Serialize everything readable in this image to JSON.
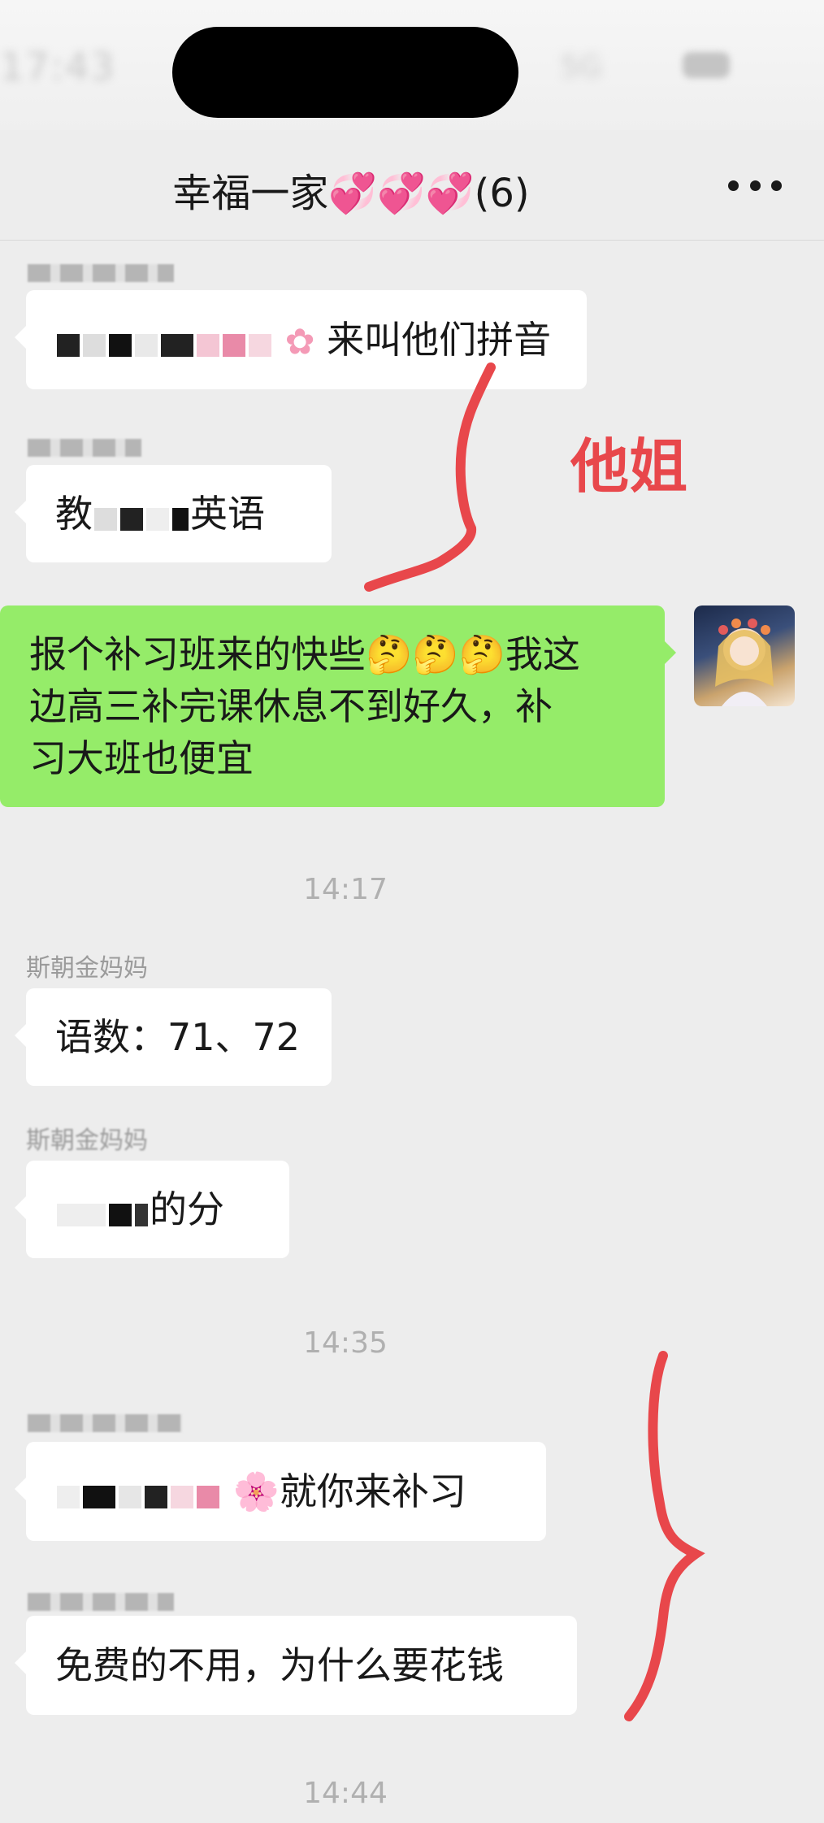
{
  "status_bar": {
    "time": "17:43",
    "network": "5G"
  },
  "header": {
    "title": "幸福一家💞💞💞(6)"
  },
  "messages": [
    {
      "text": "来叫他们拼音",
      "sender": ""
    },
    {
      "text": "英语",
      "prefix": "教",
      "sender": ""
    },
    {
      "text": "报个补习班来的快些🤔🤔🤔我这边高三补完课休息不到好久，补习大班也便宜",
      "line1": "报个补习班来的快些🤔🤔🤔我这",
      "line2": "边高三补完课休息不到好久，补",
      "line3": "习大班也便宜"
    },
    {
      "sender": "斯朝金妈妈",
      "text": "语数：71、72"
    },
    {
      "sender": "斯朝金妈妈",
      "text": "的分"
    },
    {
      "text": "🌸就你来补习",
      "sender": ""
    },
    {
      "text": "免费的不用，为什么要花钱",
      "sender": ""
    }
  ],
  "timestamps": [
    "14:17",
    "14:35",
    "14:44"
  ],
  "annotation": {
    "text": "他姐",
    "color": "#e8474b"
  },
  "colors": {
    "my_bubble": "#95ec69",
    "their_bubble": "#ffffff",
    "background": "#ededed"
  }
}
